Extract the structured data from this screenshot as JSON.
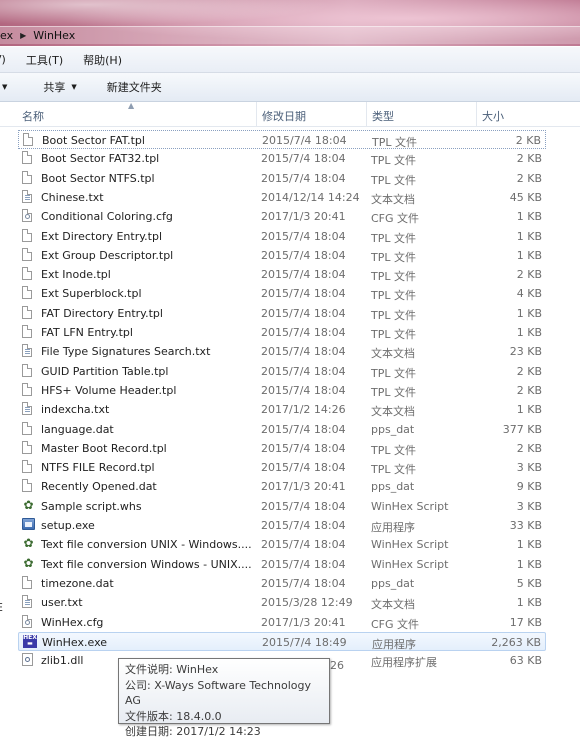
{
  "window": {
    "breadcrumb_partial": "ex",
    "breadcrumb_current": "WinHex"
  },
  "menu": {
    "items": [
      "V)",
      "工具(T)",
      "帮助(H)"
    ]
  },
  "toolbar": {
    "share_label": "共享",
    "new_folder_label": "新建文件夹"
  },
  "columns": {
    "name": "名称",
    "date": "修改日期",
    "type": "类型",
    "size": "大小"
  },
  "files": [
    {
      "name": "Boot Sector FAT.tpl",
      "date": "2015/7/4 18:04",
      "type": "TPL 文件",
      "size": "2 KB",
      "icon": "document-icon"
    },
    {
      "name": "Boot Sector FAT32.tpl",
      "date": "2015/7/4 18:04",
      "type": "TPL 文件",
      "size": "2 KB",
      "icon": "document-icon"
    },
    {
      "name": "Boot Sector NTFS.tpl",
      "date": "2015/7/4 18:04",
      "type": "TPL 文件",
      "size": "2 KB",
      "icon": "document-icon"
    },
    {
      "name": "Chinese.txt",
      "date": "2014/12/14 14:24",
      "type": "文本文档",
      "size": "45 KB",
      "icon": "text-file-icon"
    },
    {
      "name": "Conditional Coloring.cfg",
      "date": "2017/1/3 20:41",
      "type": "CFG 文件",
      "size": "1 KB",
      "icon": "config-file-icon"
    },
    {
      "name": "Ext Directory Entry.tpl",
      "date": "2015/7/4 18:04",
      "type": "TPL 文件",
      "size": "1 KB",
      "icon": "document-icon"
    },
    {
      "name": "Ext Group Descriptor.tpl",
      "date": "2015/7/4 18:04",
      "type": "TPL 文件",
      "size": "1 KB",
      "icon": "document-icon"
    },
    {
      "name": "Ext Inode.tpl",
      "date": "2015/7/4 18:04",
      "type": "TPL 文件",
      "size": "2 KB",
      "icon": "document-icon"
    },
    {
      "name": "Ext Superblock.tpl",
      "date": "2015/7/4 18:04",
      "type": "TPL 文件",
      "size": "4 KB",
      "icon": "document-icon"
    },
    {
      "name": "FAT Directory Entry.tpl",
      "date": "2015/7/4 18:04",
      "type": "TPL 文件",
      "size": "1 KB",
      "icon": "document-icon"
    },
    {
      "name": "FAT LFN Entry.tpl",
      "date": "2015/7/4 18:04",
      "type": "TPL 文件",
      "size": "1 KB",
      "icon": "document-icon"
    },
    {
      "name": "File Type Signatures Search.txt",
      "date": "2015/7/4 18:04",
      "type": "文本文档",
      "size": "23 KB",
      "icon": "text-file-icon"
    },
    {
      "name": "GUID Partition Table.tpl",
      "date": "2015/7/4 18:04",
      "type": "TPL 文件",
      "size": "2 KB",
      "icon": "document-icon"
    },
    {
      "name": "HFS+ Volume Header.tpl",
      "date": "2015/7/4 18:04",
      "type": "TPL 文件",
      "size": "2 KB",
      "icon": "document-icon"
    },
    {
      "name": "indexcha.txt",
      "date": "2017/1/2 14:26",
      "type": "文本文档",
      "size": "1 KB",
      "icon": "text-file-icon"
    },
    {
      "name": "language.dat",
      "date": "2015/7/4 18:04",
      "type": "pps_dat",
      "size": "377 KB",
      "icon": "document-icon"
    },
    {
      "name": "Master Boot Record.tpl",
      "date": "2015/7/4 18:04",
      "type": "TPL 文件",
      "size": "2 KB",
      "icon": "document-icon"
    },
    {
      "name": "NTFS FILE Record.tpl",
      "date": "2015/7/4 18:04",
      "type": "TPL 文件",
      "size": "3 KB",
      "icon": "document-icon"
    },
    {
      "name": "Recently Opened.dat",
      "date": "2017/1/3 20:41",
      "type": "pps_dat",
      "size": "9 KB",
      "icon": "document-icon"
    },
    {
      "name": "Sample script.whs",
      "date": "2015/7/4 18:04",
      "type": "WinHex Script",
      "size": "3 KB",
      "icon": "script-icon"
    },
    {
      "name": "setup.exe",
      "date": "2015/7/4 18:04",
      "type": "应用程序",
      "size": "33 KB",
      "icon": "executable-icon"
    },
    {
      "name": "Text file conversion UNIX - Windows....",
      "date": "2015/7/4 18:04",
      "type": "WinHex Script",
      "size": "1 KB",
      "icon": "script-icon"
    },
    {
      "name": "Text file conversion Windows - UNIX....",
      "date": "2015/7/4 18:04",
      "type": "WinHex Script",
      "size": "1 KB",
      "icon": "script-icon"
    },
    {
      "name": "timezone.dat",
      "date": "2015/7/4 18:04",
      "type": "pps_dat",
      "size": "5 KB",
      "icon": "document-icon"
    },
    {
      "name": "user.txt",
      "date": "2015/3/28 12:49",
      "type": "文本文档",
      "size": "1 KB",
      "icon": "text-file-icon"
    },
    {
      "name": "WinHex.cfg",
      "date": "2017/1/3 20:41",
      "type": "CFG 文件",
      "size": "17 KB",
      "icon": "config-file-icon"
    },
    {
      "name": "WinHex.exe",
      "date": "2015/7/4 18:49",
      "type": "应用程序",
      "size": "2,263 KB",
      "icon": "winhex-icon"
    },
    {
      "name": "zlib1.dll",
      "date": "",
      "type": "应用程序扩展",
      "size": "63 KB",
      "icon": "dll-icon"
    }
  ],
  "zlib_date_partial": "26",
  "left_edge_letter": "E",
  "tooltip": {
    "desc": "文件说明: WinHex",
    "company": "公司: X-Ways Software Technology AG",
    "version": "文件版本: 18.4.0.0",
    "created": "创建日期: 2017/1/2 14:23"
  }
}
